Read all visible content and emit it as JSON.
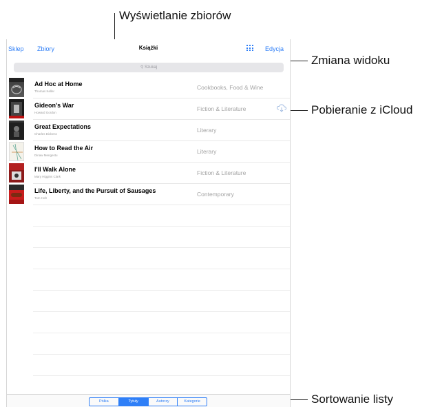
{
  "callouts": {
    "collections": "Wyświetlanie zbiorów",
    "view_change": "Zmiana widoku",
    "icloud_download": "Pobieranie z iCloud",
    "sort_list": "Sortowanie listy"
  },
  "nav": {
    "store": "Sklep",
    "collections": "Zbiory",
    "title": "Książki",
    "edit": "Edycja"
  },
  "search": {
    "placeholder": "Szukaj"
  },
  "books": [
    {
      "title": "Ad Hoc at Home",
      "author": "Thomas Keller",
      "category": "Cookbooks, Food & Wine"
    },
    {
      "title": "Gideon's War",
      "author": "Howard Gordon",
      "category": "Fiction & Literature"
    },
    {
      "title": "Great Expectations",
      "author": "Charles Dickens",
      "category": "Literary"
    },
    {
      "title": "How to Read the Air",
      "author": "Dinaw Mengestu",
      "category": "Literary"
    },
    {
      "title": "I'll Walk Alone",
      "author": "Mary Higgins Clark",
      "category": "Fiction & Literature"
    },
    {
      "title": "Life, Liberty, and the Pursuit of Sausages",
      "author": "Tom Holt",
      "category": "Contemporary"
    }
  ],
  "sort_tabs": [
    "Półka",
    "Tytuły",
    "Autorzy",
    "Kategorie"
  ],
  "active_sort_tab": "Tytuły",
  "colors": {
    "accent": "#2f7ff7"
  }
}
